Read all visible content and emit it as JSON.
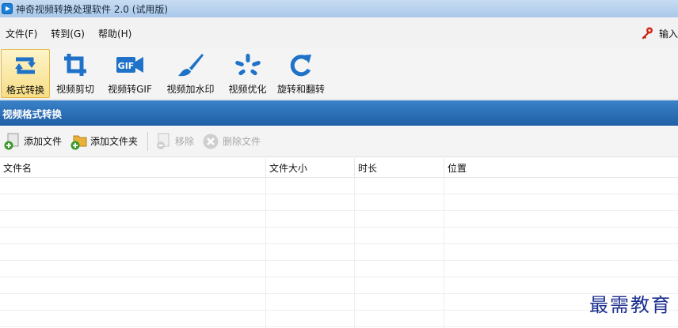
{
  "window": {
    "title": "神奇视频转换处理软件 2.0 (试用版)"
  },
  "menu": {
    "items": [
      {
        "label": "文件(F)"
      },
      {
        "label": "转到(G)"
      },
      {
        "label": "帮助(H)"
      }
    ],
    "register_label": "输入"
  },
  "toolbar": {
    "items": [
      {
        "label": "格式转换",
        "icon": "format-convert-icon",
        "active": true
      },
      {
        "label": "视频剪切",
        "icon": "crop-icon"
      },
      {
        "label": "视频转GIF",
        "icon": "gif-icon"
      },
      {
        "label": "视频加水印",
        "icon": "brush-icon"
      },
      {
        "label": "视频优化",
        "icon": "optimize-icon"
      },
      {
        "label": "旋转和翻转",
        "icon": "rotate-icon"
      }
    ]
  },
  "section": {
    "title": "视频格式转换"
  },
  "filebar": {
    "add_file": "添加文件",
    "add_folder": "添加文件夹",
    "remove": "移除",
    "delete_files": "删除文件"
  },
  "table": {
    "columns": [
      "文件名",
      "文件大小",
      "时长",
      "位置"
    ]
  },
  "watermark": "最需教育",
  "colors": {
    "accent": "#1f6fc5",
    "header": "#2a6db3",
    "active_tool": "#f7dd85"
  }
}
